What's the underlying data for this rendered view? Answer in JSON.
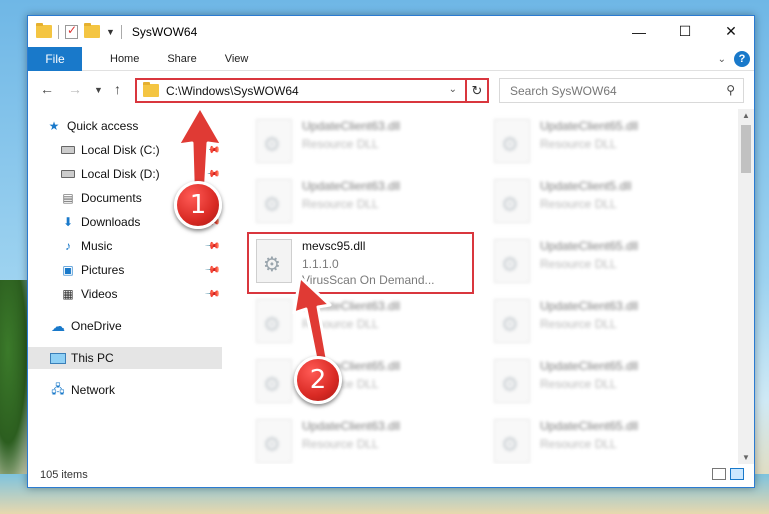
{
  "window": {
    "title": "SysWOW64",
    "controls": {
      "minimize": "—",
      "maximize": "☐",
      "close": "✕"
    }
  },
  "ribbon": {
    "file": "File",
    "tabs": [
      "Home",
      "Share",
      "View"
    ],
    "help": "?"
  },
  "address": {
    "path": "C:\\Windows\\SysWOW64",
    "search_placeholder": "Search SysWOW64"
  },
  "nav": {
    "items": [
      {
        "label": "Quick access",
        "icon": "star-icon"
      },
      {
        "label": "Local Disk (C:)",
        "icon": "disk-icon",
        "pinned": true
      },
      {
        "label": "Local Disk (D:)",
        "icon": "disk-icon",
        "pinned": true
      },
      {
        "label": "Documents",
        "icon": "documents-icon",
        "pinned": true
      },
      {
        "label": "Downloads",
        "icon": "download-icon",
        "pinned": true
      },
      {
        "label": "Music",
        "icon": "music-icon",
        "pinned": true
      },
      {
        "label": "Pictures",
        "icon": "pictures-icon",
        "pinned": true
      },
      {
        "label": "Videos",
        "icon": "videos-icon",
        "pinned": true
      },
      {
        "label": "OneDrive",
        "icon": "cloud-icon"
      },
      {
        "label": "This PC",
        "icon": "computer-icon",
        "selected": true
      },
      {
        "label": "Network",
        "icon": "network-icon"
      }
    ]
  },
  "files": {
    "highlighted": {
      "name": "mevsc95.dll",
      "version": "1.1.1.0",
      "description": "VirusScan On Demand..."
    },
    "blurred": [
      {
        "name": "UpdateClient63.dll",
        "sub": "Resource DLL"
      },
      {
        "name": "UpdateClient65.dll",
        "sub": "Resource DLL"
      },
      {
        "name": "UpdateClient63.dll",
        "sub": "Resource DLL"
      },
      {
        "name": "UpdateClient5.dll",
        "sub": "Resource DLL"
      },
      {
        "name": "UpdateClient65.dll",
        "sub": "Resource DLL"
      },
      {
        "name": "UpdateClient65.dll",
        "sub": "Resource DLL"
      },
      {
        "name": "UpdateClient63.dll",
        "sub": "Resource DLL"
      },
      {
        "name": "UpdateClient63.dll",
        "sub": "Resource DLL"
      },
      {
        "name": "UpdateClient65.dll",
        "sub": "Resource DLL"
      },
      {
        "name": "UpdateClient65.dll",
        "sub": "Resource DLL"
      },
      {
        "name": "UpdateClient63.dll",
        "sub": "Resource DLL"
      },
      {
        "name": "UpdateClient65.dll",
        "sub": "Resource DLL"
      },
      {
        "name": "UpdateClient5.dll",
        "sub": "Resource DLL"
      }
    ]
  },
  "status": {
    "count": "105 items"
  },
  "callouts": {
    "one": "1",
    "two": "2"
  },
  "colors": {
    "accent": "#1979ca",
    "highlight": "#d9363e",
    "selection": "#cce8ff"
  }
}
